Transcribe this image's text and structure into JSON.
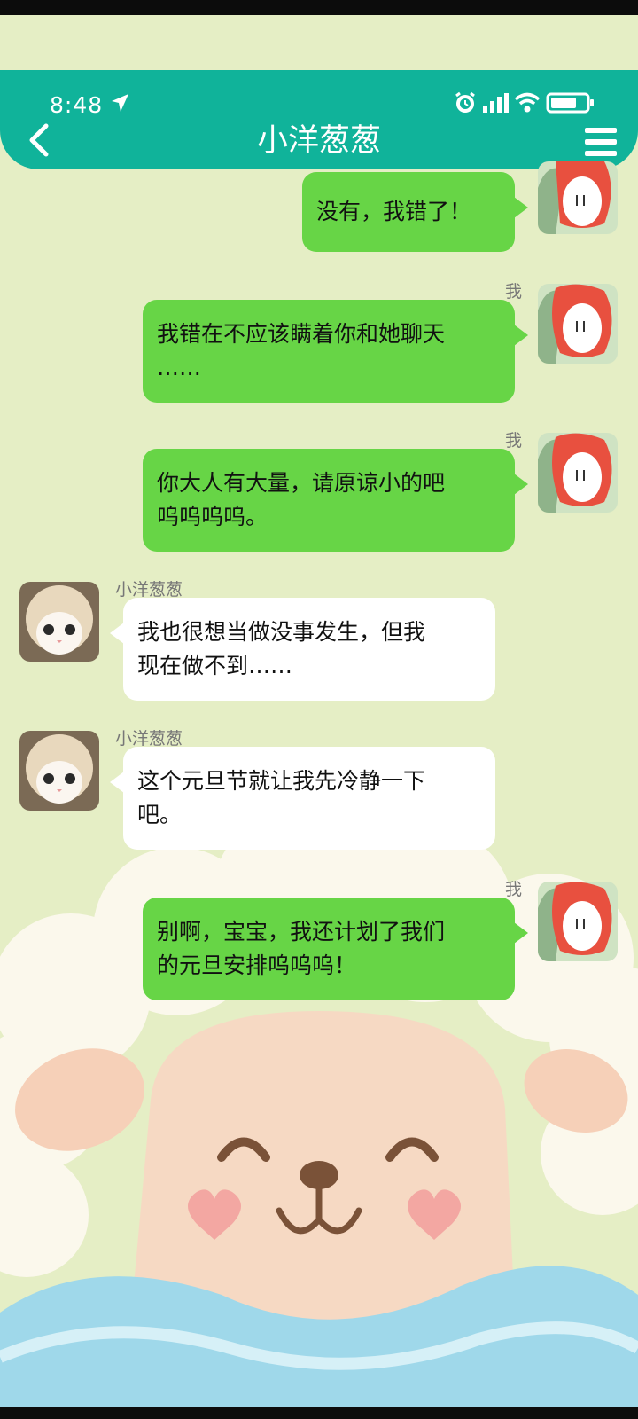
{
  "status_bar": {
    "time": "8:48"
  },
  "header": {
    "title": "小洋葱葱"
  },
  "colors": {
    "header": "#10b39a",
    "sent_bubble": "#67d546",
    "received_bubble": "#ffffff",
    "background": "#e5eec5"
  },
  "messages": [
    {
      "sender": "",
      "text": "没有，我错了！",
      "side": "right"
    },
    {
      "sender": "我",
      "text": "我错在不应该瞒着你和她聊天\n……",
      "side": "right"
    },
    {
      "sender": "我",
      "text": "你大人有大量，请原谅小的吧\n呜呜呜呜。",
      "side": "right"
    },
    {
      "sender": "小洋葱葱",
      "text": "我也很想当做没事发生，但我\n现在做不到……",
      "side": "left"
    },
    {
      "sender": "小洋葱葱",
      "text": "这个元旦节就让我先冷静一下\n吧。",
      "side": "left"
    },
    {
      "sender": "我",
      "text": "别啊，宝宝，我还计划了我们\n的元旦安排呜呜呜！",
      "side": "right"
    }
  ]
}
